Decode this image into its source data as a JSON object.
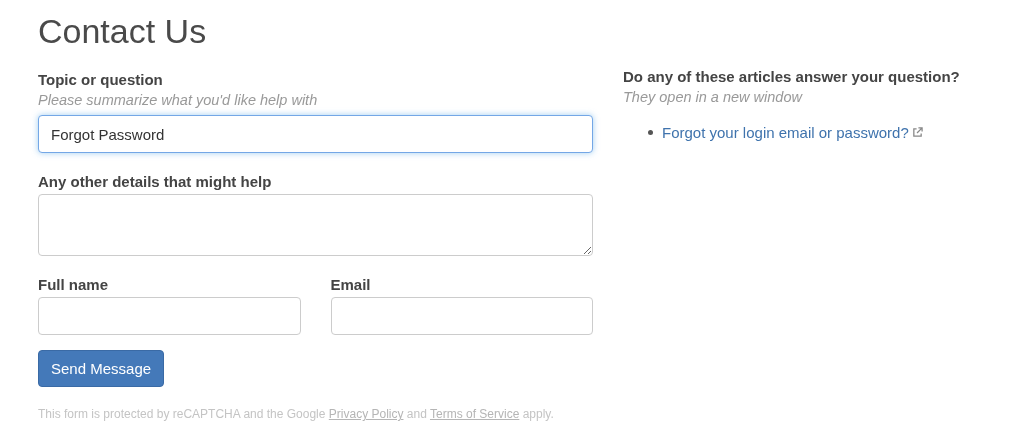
{
  "title": "Contact Us",
  "form": {
    "topic": {
      "label": "Topic or question",
      "hint": "Please summarize what you'd like help with",
      "value": "Forgot Password",
      "focused": true
    },
    "details": {
      "label": "Any other details that might help"
    },
    "full_name": {
      "label": "Full name"
    },
    "email": {
      "label": "Email"
    },
    "submit": "Send Message",
    "notice": {
      "before": "This form is protected by reCAPTCHA and the Google ",
      "privacy_link": "Privacy Policy",
      "middle": " and ",
      "terms_link": "Terms of Service",
      "after": " apply."
    }
  },
  "articles": {
    "heading": "Do any of these articles answer your question?",
    "subheading": "They open in a new window",
    "items": [
      {
        "label": "Forgot your login email or password?"
      }
    ]
  }
}
